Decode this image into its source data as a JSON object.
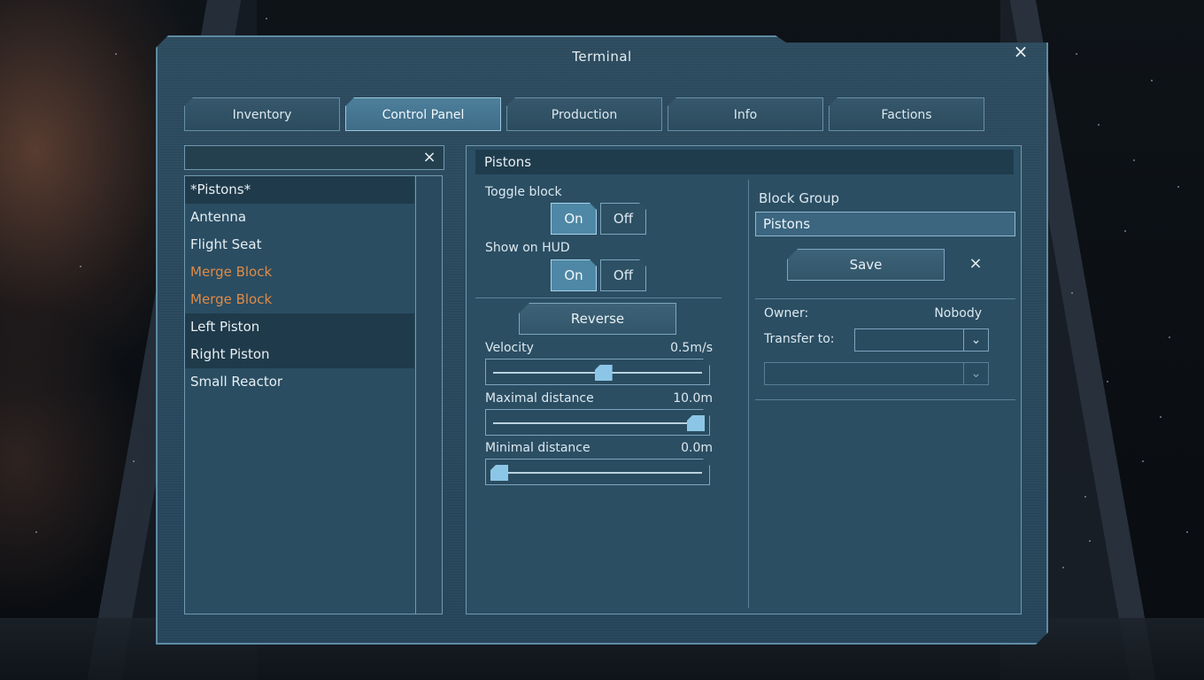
{
  "window": {
    "title": "Terminal",
    "close_icon": "×"
  },
  "tabs": [
    {
      "label": "Inventory"
    },
    {
      "label": "Control Panel",
      "active": true
    },
    {
      "label": "Production"
    },
    {
      "label": "Info"
    },
    {
      "label": "Factions"
    }
  ],
  "search": {
    "value": "",
    "clear_icon": "×"
  },
  "block_list": [
    {
      "label": "*Pistons*",
      "selected": true,
      "color": "#e6eef3"
    },
    {
      "label": "Antenna",
      "selected": false,
      "color": "#e6eef3"
    },
    {
      "label": "Flight Seat",
      "selected": false,
      "color": "#e6eef3"
    },
    {
      "label": "Merge Block",
      "selected": false,
      "color": "#e08a45"
    },
    {
      "label": "Merge Block",
      "selected": false,
      "color": "#e08a45"
    },
    {
      "label": "Left Piston",
      "selected": true,
      "color": "#e6eef3"
    },
    {
      "label": "Right Piston",
      "selected": true,
      "color": "#e6eef3"
    },
    {
      "label": "Small Reactor",
      "selected": false,
      "color": "#e6eef3"
    }
  ],
  "panel": {
    "header": "Pistons",
    "toggle_block": {
      "label": "Toggle block",
      "on_label": "On",
      "off_label": "Off",
      "state": "On"
    },
    "show_on_hud": {
      "label": "Show on HUD",
      "on_label": "On",
      "off_label": "Off",
      "state": "On"
    },
    "reverse_label": "Reverse",
    "velocity": {
      "label": "Velocity",
      "value": "0.5m/s",
      "fraction": 0.53
    },
    "max_distance": {
      "label": "Maximal distance",
      "value": "10.0m",
      "fraction": 1.0
    },
    "min_distance": {
      "label": "Minimal distance",
      "value": "0.0m",
      "fraction": 0.0
    }
  },
  "group": {
    "label": "Block Group",
    "name": "Pistons",
    "save_label": "Save",
    "clear_icon": "×"
  },
  "ownership": {
    "owner_label": "Owner:",
    "owner_value": "Nobody",
    "transfer_label": "Transfer to:",
    "dropdown_icon": "chevron-down-icon"
  },
  "colors": {
    "accent": "#4f88a6",
    "panel": "#2b4e63",
    "warning_text": "#e08a45"
  }
}
